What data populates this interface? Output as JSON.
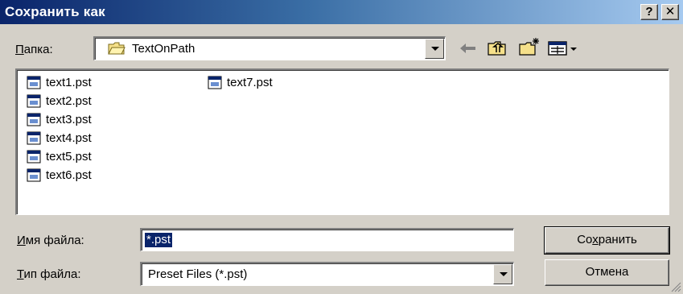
{
  "window": {
    "title": "Сохранить как",
    "help_button": "?",
    "close_button": "✕"
  },
  "folder": {
    "label_underlined": "П",
    "label_rest": "апка:",
    "value": "TextOnPath"
  },
  "toolbar": {
    "icons": [
      "back-arrow-icon",
      "up-folder-icon",
      "new-folder-icon",
      "view-menu-icon"
    ]
  },
  "files": [
    {
      "name": "text1.pst"
    },
    {
      "name": "text2.pst"
    },
    {
      "name": "text3.pst"
    },
    {
      "name": "text4.pst"
    },
    {
      "name": "text5.pst"
    },
    {
      "name": "text6.pst"
    },
    {
      "name": "text7.pst"
    }
  ],
  "filename": {
    "label_underlined": "И",
    "label_rest": "мя файла:",
    "value": "*.pst"
  },
  "filetype": {
    "label_underlined": "Т",
    "label_rest": "ип файла:",
    "value": "Preset Files (*.pst)"
  },
  "buttons": {
    "save_pre": "Со",
    "save_underlined": "х",
    "save_post": "ранить",
    "cancel": "Отмена"
  },
  "colors": {
    "titlebar_start": "#0a246a",
    "titlebar_end": "#a6caf0",
    "face": "#d4d0c8",
    "selection": "#0a246a"
  }
}
